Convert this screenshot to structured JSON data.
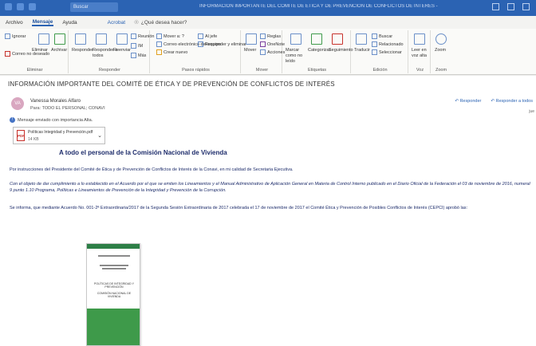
{
  "titlebar": {
    "search": "Buscar",
    "title": "INFORMACIÓN IMPORTANTE DEL COMITÉ DE ÉTICA Y DE PREVENCIÓN DE CONFLICTOS DE INTERÉS - Mensaje"
  },
  "tabs": {
    "archivo": "Archivo",
    "mensaje": "Mensaje",
    "ayuda": "Ayuda",
    "acrobat": "Acrobat",
    "tell_me": "¿Qué desea hacer?"
  },
  "ribbon": {
    "groups": {
      "eliminar": "Eliminar",
      "responder": "Responder",
      "pasos_rapidos": "Pasos rápidos",
      "mover": "Mover",
      "etiquetas": "Etiquetas",
      "edicion": "Edición",
      "voz": "Voz",
      "zoom": "Zoom"
    },
    "buttons": {
      "ignorar": "Ignorar",
      "correo_no_deseado": "Correo no deseado",
      "eliminar": "Eliminar",
      "archivar": "Archivar",
      "responder": "Responder",
      "responder_todos": "Responder a todos",
      "reenviar": "Reenviar",
      "reunion": "Reunión",
      "im": "IM",
      "mas": "Más",
      "pq_mover": "Mover a: ?",
      "pq_jefe": "Al jefe",
      "pq_correo_equipo": "Correo electrónico del equipo",
      "pq_hecho": "Hecho",
      "pq_responder_eliminar": "Responder y eliminar",
      "pq_crear_nuevo": "Crear nuevo",
      "mover": "Mover",
      "reglas": "Reglas",
      "onenote": "OneNote",
      "acciones": "Acciones",
      "marcar_no_leido": "Marcar como no leído",
      "categorizar": "Categorizar",
      "seguimiento": "Seguimiento",
      "traducir": "Traducir",
      "buscar": "Buscar",
      "relacionado": "Relacionado",
      "seleccionar": "Seleccionar",
      "leer_en_voz_alta": "Leer en voz alta",
      "zoom": "Zoom"
    }
  },
  "message": {
    "subject": "INFORMACIÓN IMPORTANTE DEL COMITÉ DE ÉTICA Y DE PREVENCIÓN DE CONFLICTOS DE INTERÉS",
    "avatar_initials": "VA",
    "sender": "Vanessa Morales Alfaro",
    "recipients": "Para:  TODO EL PERSONAL; CONAVI",
    "importance_note": "Mensaje enviado con importancia Alta.",
    "reply": "Responder",
    "reply_all": "Responder a todos",
    "date": "jue",
    "attachment": {
      "name": "Políticas Integridad y Prevención.pdf",
      "size": "14 KB"
    },
    "body_heading": "A todo el personal de la Comisión Nacional de Vivienda",
    "paragraph_1": "Por instrucciones del Presidente del Comité de Ética y de Prevención de Conflictos de Interés de la Conavi, en mi calidad de Secretaria Ejecutiva.",
    "paragraph_2": "Con el objeto de dar cumplimiento a lo establecido en el Acuerdo por el que se emiten los Lineamientos y el Manual Administrativo de Aplicación General en Materia de Control Interno publicado en el Diario Oficial de la Federación el 03 de noviembre de 2016, numeral 9 punto 1.10 Programa, Políticas e Lineamientos de Prevención de la Integridad y Prevención de la Corrupción.",
    "paragraph_3": "Se informa, que mediante Acuerdo No. 001-2ª Extraordinaria/2017 de la Segunda Sesión Extraordinaria de 2017 celebrada el 17 de noviembre de 2017 el Comité Ética y Prevención de Posibles Conflictos de Interés (CEPCI) aprobó las:",
    "doc_title": "POLÍTICAS DE INTEGRIDAD Y PREVENCIÓN",
    "doc_subtitle": "COMISIÓN NACIONAL DE VIVIENDA"
  },
  "colors": {
    "accent": "#2b63b3",
    "body_text": "#1d2c6b",
    "doc_green": "#3e9a4a"
  }
}
